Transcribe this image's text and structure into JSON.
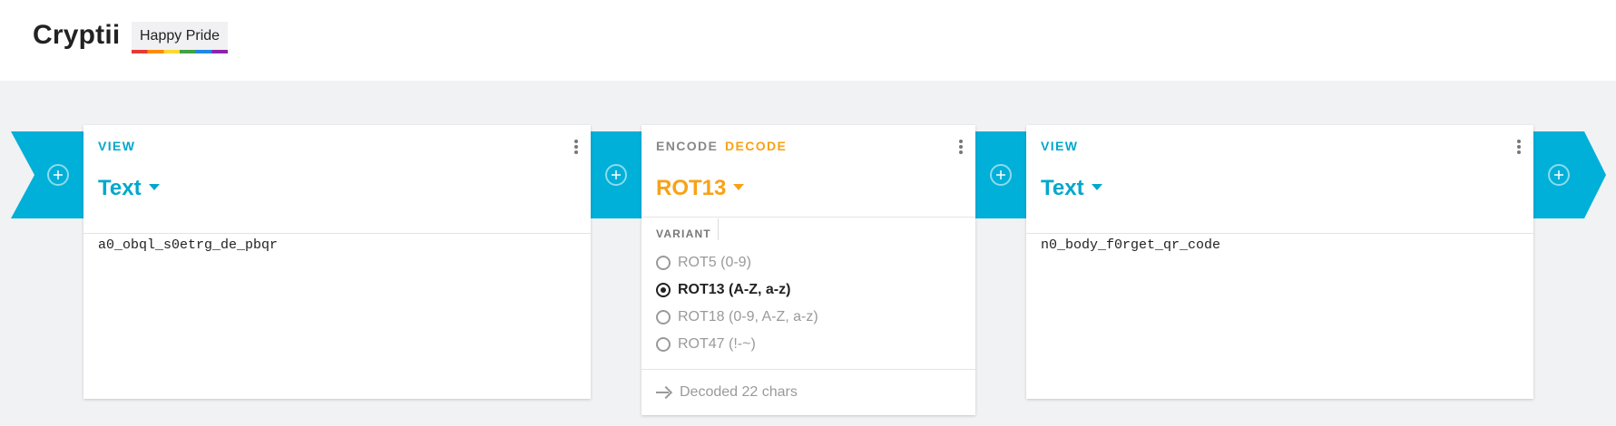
{
  "header": {
    "logo": "Cryptii",
    "badge": "Happy Pride"
  },
  "cards": [
    {
      "mode": "VIEW",
      "title": "Text",
      "content": "a0_obql_s0etrg_de_pbqr"
    },
    {
      "mode_encode": "ENCODE",
      "mode_decode": "DECODE",
      "active_mode": "DECODE",
      "title": "ROT13",
      "settings_label": "VARIANT",
      "variants": [
        {
          "label": "ROT5 (0-9)",
          "selected": false
        },
        {
          "label": "ROT13 (A-Z, a-z)",
          "selected": true
        },
        {
          "label": "ROT18 (0-9, A-Z, a-z)",
          "selected": false
        },
        {
          "label": "ROT47 (!-~)",
          "selected": false
        }
      ],
      "status": "Decoded 22 chars"
    },
    {
      "mode": "VIEW",
      "title": "Text",
      "content": "n0_body_f0rget_qr_code"
    }
  ],
  "colors": {
    "accent_teal": "#00b0d8",
    "accent_orange": "#f8a216",
    "background": "#f1f2f4"
  },
  "icons": [
    "plus-circle-icon",
    "kebab-menu-icon",
    "chevron-down-icon",
    "arrow-right-icon",
    "radio-icon"
  ]
}
